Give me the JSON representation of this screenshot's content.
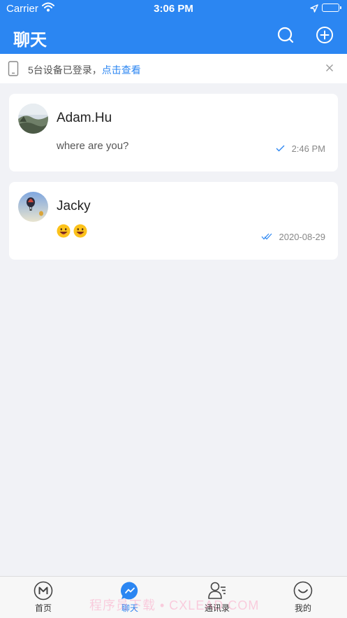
{
  "status_bar": {
    "carrier": "Carrier",
    "time": "3:06 PM"
  },
  "nav": {
    "title": "聊天",
    "icons": [
      "search-icon",
      "add-circle-icon"
    ]
  },
  "banner": {
    "text": "5台设备已登录，",
    "link": "点击查看",
    "icons": [
      "phone-icon",
      "close-icon"
    ]
  },
  "chats": [
    {
      "name": "Adam.Hu",
      "message": "where are you?",
      "time": "2:46 PM",
      "status": "sent",
      "avatar": "landscape"
    },
    {
      "name": "Jacky",
      "message": "😀😀",
      "time": "2020-08-29",
      "status": "read",
      "avatar": "balloons"
    }
  ],
  "tabs": [
    {
      "label": "首页",
      "icon": "home-m-icon",
      "active": false
    },
    {
      "label": "聊天",
      "icon": "chat-icon",
      "active": true
    },
    {
      "label": "通讯录",
      "icon": "contacts-icon",
      "active": false
    },
    {
      "label": "我的",
      "icon": "profile-smile-icon",
      "active": false
    }
  ],
  "watermark": "程序员下载 • CXLEAD.COM",
  "colors": {
    "primary": "#2b86f2",
    "background": "#f1f2f6"
  }
}
